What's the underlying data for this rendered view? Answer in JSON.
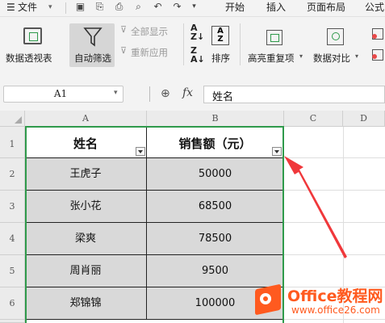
{
  "menu": {
    "file_label": "文件",
    "tabs": [
      "开始",
      "插入",
      "页面布局",
      "公式"
    ]
  },
  "ribbon": {
    "pivot_table": "数据透视表",
    "auto_filter": "自动筛选",
    "show_all": "全部显示",
    "reapply": "重新应用",
    "sort": "排序",
    "highlight_duplicates": "高亮重复项",
    "data_compare": "数据对比"
  },
  "formula_bar": {
    "name_box": "A1",
    "fx_label": "fx",
    "content": "姓名"
  },
  "sheet": {
    "columns": [
      "A",
      "B",
      "C",
      "D"
    ],
    "rows": [
      "1",
      "2",
      "3",
      "4",
      "5",
      "6"
    ],
    "header": [
      "姓名",
      "销售额（元）"
    ],
    "data": [
      [
        "王虎子",
        "50000"
      ],
      [
        "张小花",
        "68500"
      ],
      [
        "梁爽",
        "78500"
      ],
      [
        "周肖丽",
        "9500"
      ],
      [
        "郑锦锦",
        "100000"
      ]
    ]
  },
  "watermark": {
    "brand": "Office教程网",
    "url": "www.office26.com"
  },
  "colors": {
    "selection": "#2f9a4b",
    "arrow": "#f0383b",
    "data_fill": "#d9d9d9",
    "watermark": "#ff5a1f"
  }
}
